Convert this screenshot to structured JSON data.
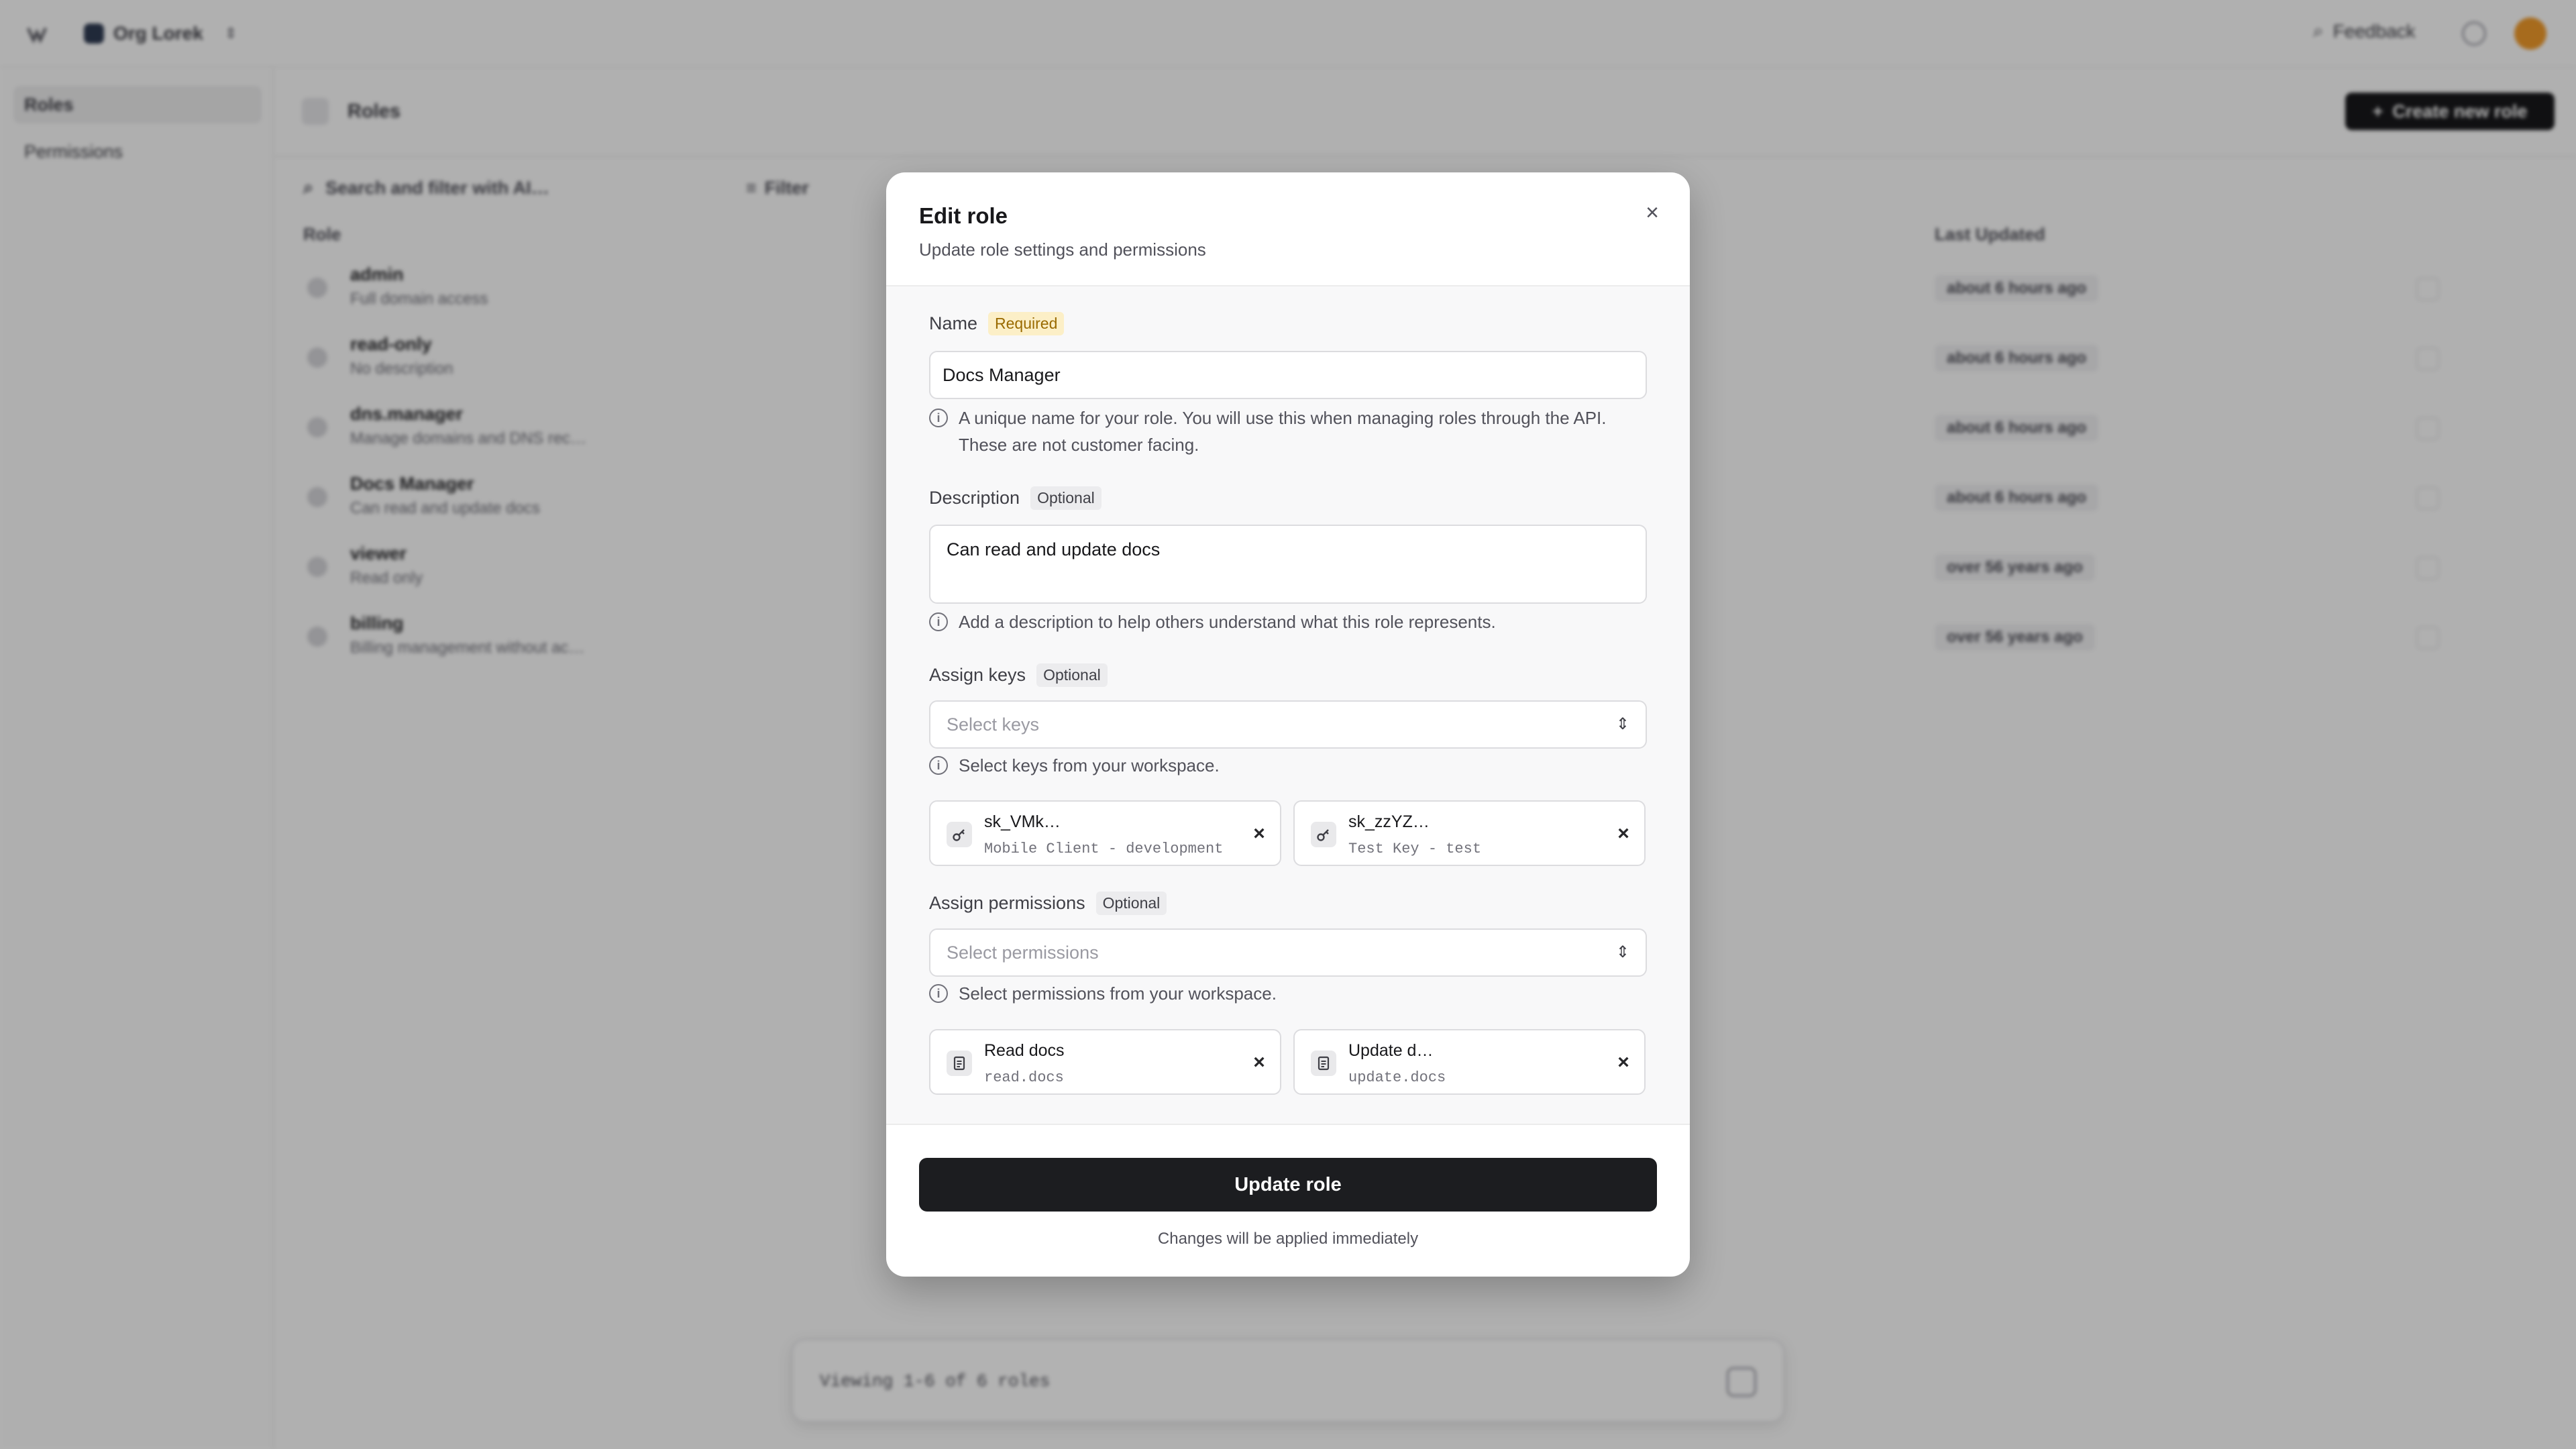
{
  "app": {
    "workspace_name": "Org Lorek",
    "feedback_label": "Feedback"
  },
  "sidebar": {
    "items": [
      {
        "label": "Roles"
      },
      {
        "label": "Permissions"
      }
    ]
  },
  "page": {
    "title": "Roles",
    "create_button": "Create new role",
    "search_placeholder": "Search and filter with AI…",
    "filter_label": "Filter",
    "columns": [
      "Role",
      "Last Updated"
    ],
    "rows": [
      {
        "name": "admin",
        "description": "Full domain access",
        "updated": "about 6 hours ago"
      },
      {
        "name": "read-only",
        "description": "No description",
        "updated": "about 6 hours ago"
      },
      {
        "name": "dns.manager",
        "description": "Manage domains and DNS rec…",
        "updated": "about 6 hours ago"
      },
      {
        "name": "Docs Manager",
        "description": "Can read and update docs",
        "updated": "about 6 hours ago"
      },
      {
        "name": "viewer",
        "description": "Read only",
        "updated": "over 56 years ago"
      },
      {
        "name": "billing",
        "description": "Billing management without ac…",
        "updated": "over 56 years ago"
      }
    ],
    "pager_text": "Viewing 1-6 of 6 roles"
  },
  "modal": {
    "title": "Edit role",
    "subtitle": "Update role settings and permissions",
    "name": {
      "label": "Name",
      "badge": "Required",
      "value": "Docs Manager",
      "hint_line1": "A unique name for your role. You will use this when managing roles through the API.",
      "hint_line2": "These are not customer facing."
    },
    "description": {
      "label": "Description",
      "badge": "Optional",
      "value": "Can read and update docs",
      "hint": "Add a description to help others understand what this role represents."
    },
    "keys": {
      "label": "Assign keys",
      "badge": "Optional",
      "placeholder": "Select keys",
      "hint": "Select keys from your workspace.",
      "items": [
        {
          "title": "sk_VMk…",
          "subtitle": "Mobile Client - development"
        },
        {
          "title": "sk_zzYZ…",
          "subtitle": "Test Key - test"
        }
      ]
    },
    "permissions": {
      "label": "Assign permissions",
      "badge": "Optional",
      "placeholder": "Select permissions",
      "hint": "Select permissions from your workspace.",
      "items": [
        {
          "title": "Read docs",
          "subtitle": "read.docs"
        },
        {
          "title": "Update d…",
          "subtitle": "update.docs"
        }
      ]
    },
    "submit_label": "Update role",
    "footer_note": "Changes will be applied immediately"
  }
}
